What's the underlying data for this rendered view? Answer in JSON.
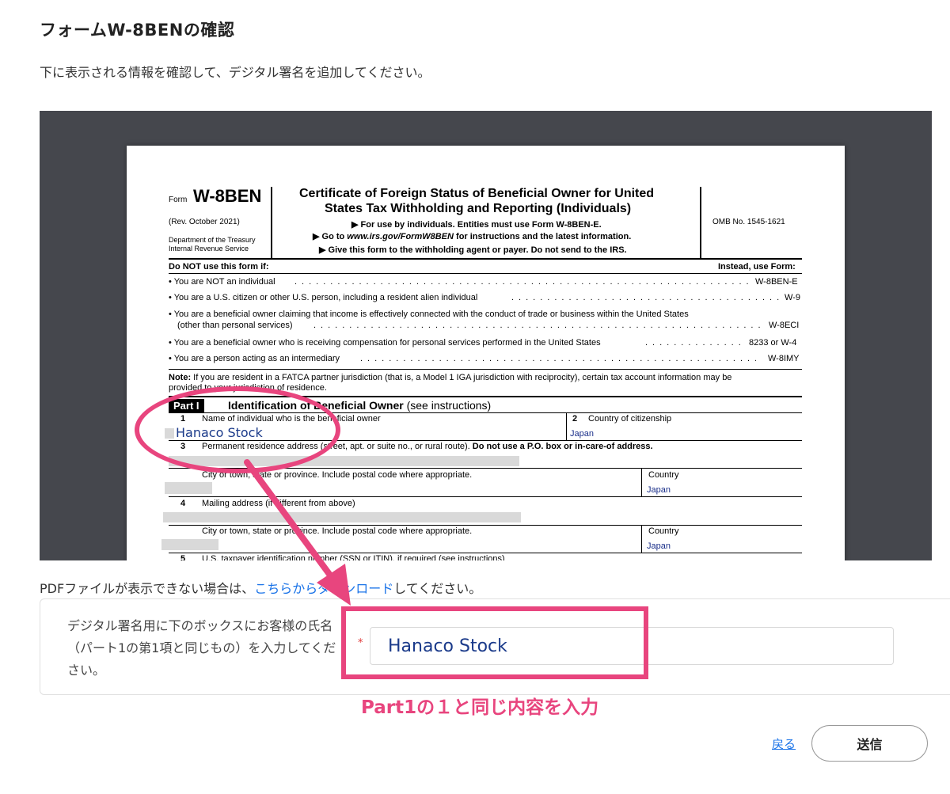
{
  "page": {
    "title": "フォームW-8BENの確認",
    "subtitle": "下に表示される情報を確認して、デジタル署名を追加してください。"
  },
  "pdf": {
    "form_label": "Form",
    "form_number": "W-8BEN",
    "rev": "(Rev. October  2021)",
    "dept_line1": "Department of the Treasury",
    "dept_line2": "Internal Revenue Service",
    "cert_title_line1": "Certificate of Foreign Status of Beneficial Owner for United",
    "cert_title_line2": "States Tax Withholding and Reporting (Individuals)",
    "instr1": "▶ For use by individuals. Entities must use Form W-8BEN-E.",
    "instr2_pre": "▶ Go to ",
    "instr2_url": "www.irs.gov/FormW8BEN",
    "instr2_post": " for instructions and the latest information.",
    "instr3": "▶ Give this form to the withholding agent or payer. Do not send to the IRS.",
    "omb": "OMB No. 1545-1621",
    "do_not_use": "Do NOT use this form if:",
    "instead_use": "Instead, use Form:",
    "bullets": [
      {
        "text": "• You are NOT an individual",
        "form": "W-8BEN-E"
      },
      {
        "text": "• You are a U.S. citizen or other U.S. person, including a resident alien individual",
        "form": "W-9"
      },
      {
        "text": "• You are a beneficial owner claiming that income is effectively connected with the conduct of trade or business within the United States",
        "text2": "(other than personal services)",
        "form": "W-8ECI"
      },
      {
        "text": "• You are a beneficial owner who is receiving compensation for personal services performed in the United States",
        "form": "8233 or W-4"
      },
      {
        "text": "• You are a person acting as an intermediary",
        "form": "W-8IMY"
      }
    ],
    "note_label": "Note:",
    "note_text": " If you are resident in a FATCA partner jurisdiction (that is, a Model 1 IGA jurisdiction with reciprocity), certain tax account information may be",
    "note_text2": "provided to your jurisdiction of residence.",
    "part_label": "Part I",
    "part_title": "Identification of Beneficial Owner",
    "part_title_suffix": " (see instructions)",
    "line1_num": "1",
    "line1_label": "Name of individual who is the beneficial owner",
    "line1_value": "Hanaco Stock",
    "line2_num": "2",
    "line2_label": "Country of citizenship",
    "line2_value": "Japan",
    "line3_num": "3",
    "line3_label": "Permanent residence address (street, apt. or suite no., or rural route).",
    "line3_bold": "Do not use a P.O. box or in-care-of address.",
    "city_label": "City or town, state or province. Include postal code where appropriate.",
    "country_label": "Country",
    "country_value": "Japan",
    "line4_num": "4",
    "line4_label": "Mailing address (if different from above)",
    "city_label2": "City or town, state or province. Include postal code where appropriate.",
    "country_label2": "Country",
    "country_value2": "Japan",
    "line5_num": "5",
    "line5_label": "U.S. taxpayer identification number (SSN or ITIN), if required (see instructions)"
  },
  "pdf_note": {
    "prefix": "PDFファイルが表示できない場合は、",
    "link": "こちらからダウンロード",
    "suffix": "してください。"
  },
  "signature": {
    "label": "デジタル署名用に下のボックスにお客様の氏名（パート1の第1項と同じもの）を入力してください。",
    "required_mark": "*",
    "value": "Hanaco Stock"
  },
  "annotation": {
    "text": "Part1の１と同じ内容を入力",
    "color": "#e8457e"
  },
  "actions": {
    "back_label": "戻る",
    "submit_label": "送信"
  }
}
